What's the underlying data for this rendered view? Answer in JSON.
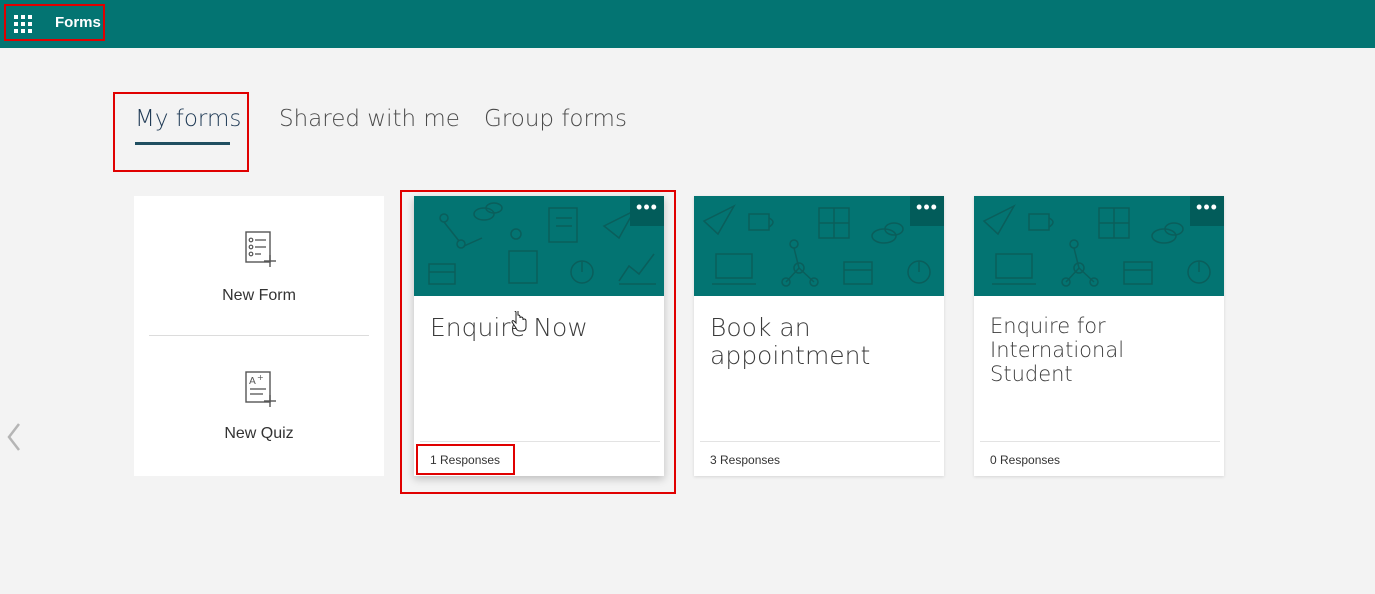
{
  "header": {
    "app_launcher_icon": "waffle-icon",
    "title": "Forms"
  },
  "tabs": [
    {
      "label": "My forms",
      "active": true
    },
    {
      "label": "Shared with me",
      "active": false
    },
    {
      "label": "Group forms",
      "active": false
    }
  ],
  "create": {
    "new_form": {
      "label": "New Form",
      "icon": "new-form-icon"
    },
    "new_quiz": {
      "label": "New Quiz",
      "icon": "new-quiz-icon"
    }
  },
  "forms": [
    {
      "title": "Enquire Now",
      "responses": "1 Responses",
      "selected": true
    },
    {
      "title": "Book an appointment",
      "responses": "3 Responses",
      "selected": false
    },
    {
      "title": "Enquire for International Student",
      "responses": "0 Responses",
      "selected": false
    }
  ],
  "more_label": "•••",
  "colors": {
    "brand": "#037472",
    "highlight": "#e00000",
    "background": "#f3f3f3"
  }
}
